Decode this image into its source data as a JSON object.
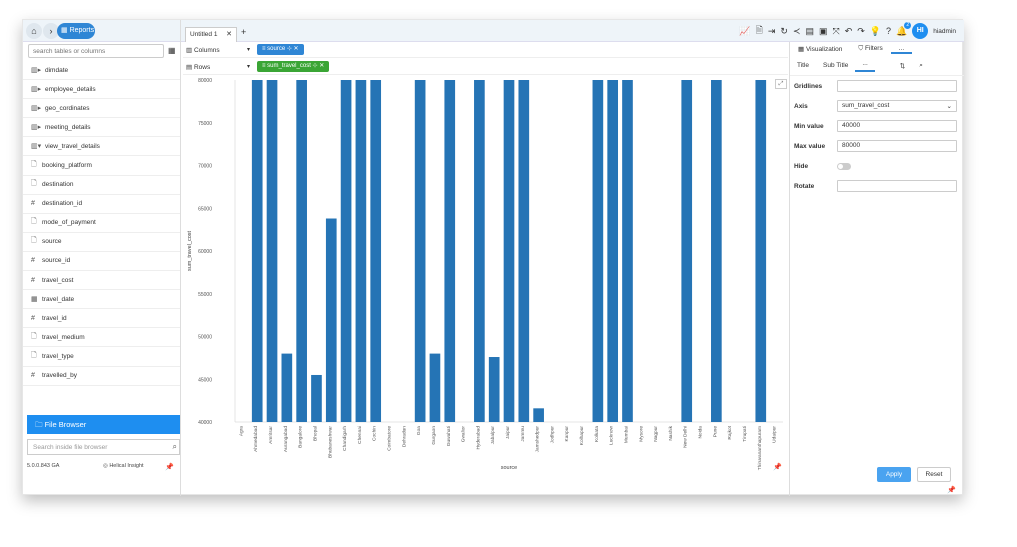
{
  "nav": {
    "reports_label": "Reports"
  },
  "search": {
    "tables_placeholder": "search tables or columns",
    "file_placeholder": "Search inside file browser"
  },
  "fields": [
    {
      "label": "dimdate",
      "kind": "table"
    },
    {
      "label": "employee_details",
      "kind": "table"
    },
    {
      "label": "geo_cordinates",
      "kind": "table"
    },
    {
      "label": "meeting_details",
      "kind": "table"
    },
    {
      "label": "view_travel_details",
      "kind": "table-open"
    },
    {
      "label": "booking_platform",
      "kind": "text"
    },
    {
      "label": "destination",
      "kind": "text"
    },
    {
      "label": "destination_id",
      "kind": "number"
    },
    {
      "label": "mode_of_payment",
      "kind": "text"
    },
    {
      "label": "source",
      "kind": "text"
    },
    {
      "label": "source_id",
      "kind": "number"
    },
    {
      "label": "travel_cost",
      "kind": "number"
    },
    {
      "label": "travel_date",
      "kind": "date"
    },
    {
      "label": "travel_id",
      "kind": "number"
    },
    {
      "label": "travel_medium",
      "kind": "text"
    },
    {
      "label": "travel_type",
      "kind": "text"
    },
    {
      "label": "travelled_by",
      "kind": "number"
    }
  ],
  "file_browser": {
    "label": "File Browser"
  },
  "footer": {
    "version": "5.0.0.843 GA",
    "brand": "Helical Insight"
  },
  "tabs": [
    {
      "label": "Untitled 1"
    }
  ],
  "user": {
    "initials": "HI",
    "name": "hiadmin",
    "notifications": "2"
  },
  "shelves": {
    "columns": {
      "label": "Columns",
      "pill": "source"
    },
    "rows": {
      "label": "Rows",
      "pill": "sum_travel_cost"
    }
  },
  "panel": {
    "tabs": [
      "Visualization",
      "Filters",
      "..."
    ],
    "subtabs": [
      "Title",
      "Sub Title",
      "..."
    ],
    "rows": {
      "gridlines": "Gridlines",
      "axis": "Axis",
      "axis_value": "sum_travel_cost",
      "min": "Min value",
      "min_value": "40000",
      "max": "Max value",
      "max_value": "80000",
      "hide": "Hide",
      "rotate": "Rotate"
    },
    "apply": "Apply",
    "reset": "Reset"
  },
  "chart_data": {
    "type": "bar",
    "xlabel": "source",
    "ylabel": "sum_travel_cost",
    "ylim": [
      40000,
      80000
    ],
    "yticks": [
      40000,
      45000,
      50000,
      55000,
      60000,
      65000,
      70000,
      75000,
      80000
    ],
    "color": "#2574b5",
    "categories": [
      "Agra",
      "Ahmedabad",
      "Amritsar",
      "Aurangabad",
      "Bangalore",
      "Bhopal",
      "Bhubaneshwar",
      "Chandigarh",
      "Chennai",
      "Cochin",
      "Coimbatore",
      "Dehradun",
      "Goa",
      "Gurgaon",
      "Guwahati",
      "Gwalior",
      "Hyderabad",
      "Jabalpur",
      "Jaipur",
      "Jammu",
      "Jamshedpur",
      "Jodhpur",
      "Kanpur",
      "Kolhapur",
      "Kolkata",
      "Lucknow",
      "Mumbai",
      "Mysore",
      "Nagpur",
      "Nashik",
      "New Delhi",
      "Noida",
      "Pune",
      "Rajkot",
      "Tirupati",
      "Thiruvananthapuram",
      "Udaipur"
    ],
    "values": [
      null,
      80000,
      80000,
      48000,
      80000,
      45500,
      63800,
      80000,
      80000,
      80000,
      null,
      null,
      80000,
      48000,
      80000,
      null,
      80000,
      47600,
      80000,
      80000,
      41600,
      null,
      null,
      null,
      80000,
      80000,
      80000,
      null,
      null,
      null,
      80000,
      null,
      80000,
      null,
      null,
      80000,
      null
    ]
  }
}
